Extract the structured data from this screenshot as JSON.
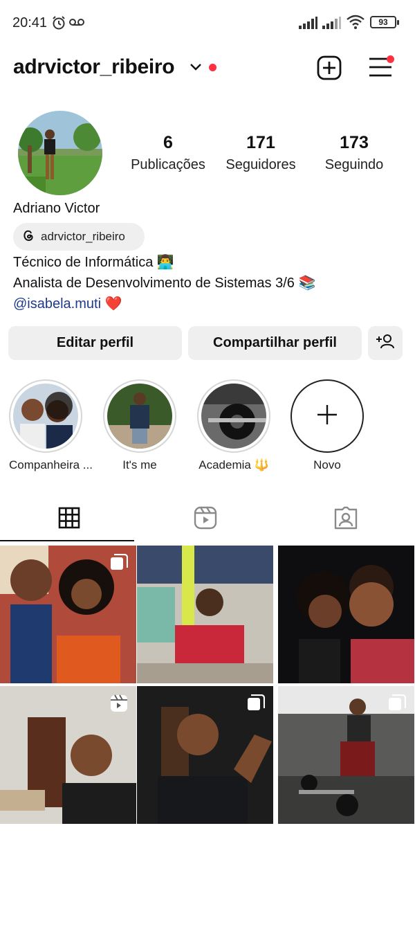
{
  "status_bar": {
    "time": "20:41",
    "battery": "93"
  },
  "header": {
    "username": "adrvictor_ribeiro"
  },
  "profile": {
    "stats": [
      {
        "value": "6",
        "label": "Publicações"
      },
      {
        "value": "171",
        "label": "Seguidores"
      },
      {
        "value": "173",
        "label": "Seguindo"
      }
    ],
    "full_name": "Adriano Victor",
    "threads_handle": "adrvictor_ribeiro",
    "bio_line1": "Técnico de Informática 👨‍💻",
    "bio_line2": "Analista de Desenvolvimento de Sistemas 3/6 📚",
    "bio_line3": "@isabela.muti ❤️"
  },
  "buttons": {
    "edit": "Editar perfil",
    "share": "Compartilhar perfil"
  },
  "highlights": [
    {
      "label": "Companheira ..."
    },
    {
      "label": "It's me"
    },
    {
      "label": "Academia 🔱"
    },
    {
      "label": "Novo"
    }
  ],
  "tabs": [
    "posts-grid",
    "reels",
    "tagged"
  ],
  "colors": {
    "accent_red": "#ff3040",
    "button_bg": "#efefef",
    "mention_blue": "#1e3a8a"
  }
}
